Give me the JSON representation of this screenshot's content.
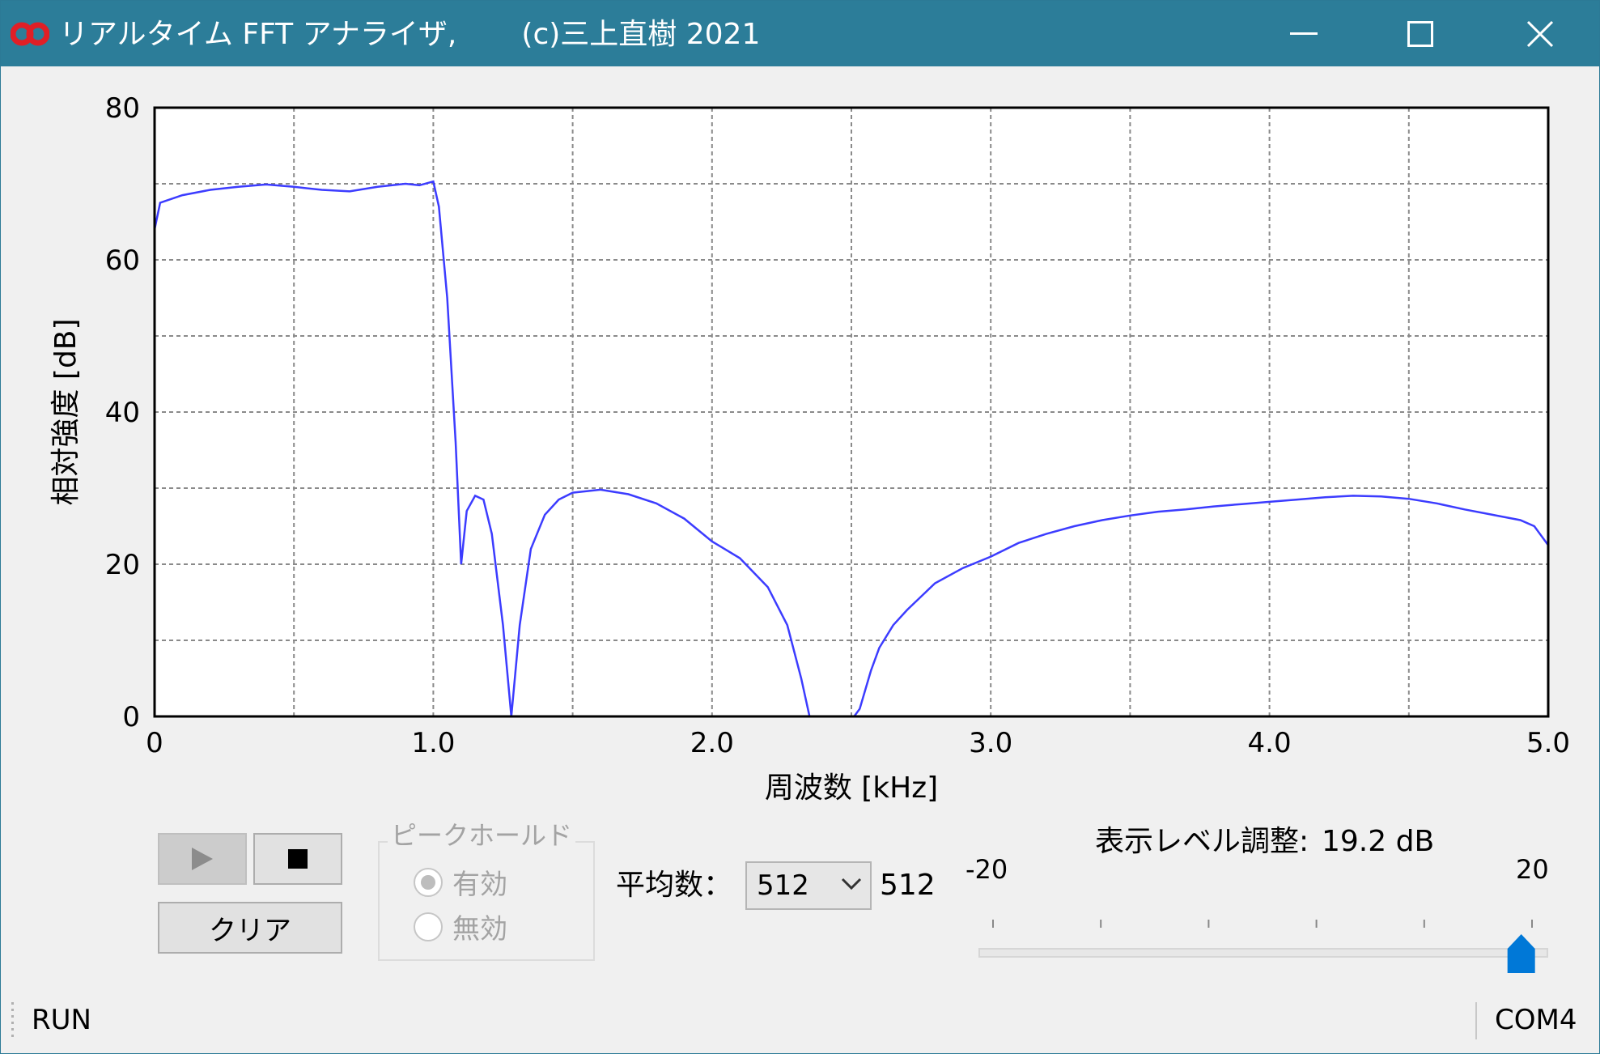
{
  "window": {
    "title": "リアルタイム FFT アナライザ,       (c)三上直樹 2021",
    "icon": "infinity-logo-icon",
    "controls": [
      "minimize-icon",
      "maximize-icon",
      "close-icon"
    ],
    "title_bar_color": "#2c7d99"
  },
  "chart_data": {
    "type": "line",
    "xlabel": "周波数 [kHz]",
    "ylabel": "相対強度 [dB]",
    "xlim": [
      0,
      5
    ],
    "ylim": [
      0,
      80
    ],
    "x_ticks": [
      0,
      1.0,
      2.0,
      3.0,
      4.0,
      5.0
    ],
    "x_tick_labels": [
      "0",
      "1.0",
      "2.0",
      "3.0",
      "4.0",
      "5.0"
    ],
    "y_ticks": [
      0,
      20,
      40,
      60,
      80
    ],
    "y_tick_labels": [
      "0",
      "20",
      "40",
      "60",
      "80"
    ],
    "grid": true,
    "line_color": "#3c3cff",
    "series": [
      {
        "values": [
          [
            0,
            64
          ],
          [
            0.02,
            67.5
          ],
          [
            0.1,
            68.5
          ],
          [
            0.2,
            69.2
          ],
          [
            0.3,
            69.6
          ],
          [
            0.4,
            69.9
          ],
          [
            0.5,
            69.6
          ],
          [
            0.6,
            69.2
          ],
          [
            0.7,
            69.0
          ],
          [
            0.8,
            69.6
          ],
          [
            0.9,
            70.0
          ],
          [
            0.95,
            69.8
          ],
          [
            1.0,
            70.3
          ],
          [
            1.02,
            67
          ],
          [
            1.05,
            55
          ],
          [
            1.08,
            36
          ],
          [
            1.1,
            20
          ],
          [
            1.12,
            27
          ],
          [
            1.15,
            29
          ],
          [
            1.18,
            28.5
          ],
          [
            1.21,
            24
          ],
          [
            1.25,
            12
          ],
          [
            1.28,
            0
          ],
          [
            1.31,
            12
          ],
          [
            1.35,
            22
          ],
          [
            1.4,
            26.5
          ],
          [
            1.45,
            28.5
          ],
          [
            1.5,
            29.4
          ],
          [
            1.6,
            29.8
          ],
          [
            1.7,
            29.2
          ],
          [
            1.8,
            28.0
          ],
          [
            1.9,
            26.0
          ],
          [
            2.0,
            23.0
          ],
          [
            2.1,
            20.8
          ],
          [
            2.2,
            17.0
          ],
          [
            2.27,
            12
          ],
          [
            2.32,
            5
          ],
          [
            2.35,
            0
          ],
          [
            2.51,
            0
          ],
          [
            2.53,
            1
          ],
          [
            2.57,
            6
          ],
          [
            2.6,
            9
          ],
          [
            2.65,
            12
          ],
          [
            2.7,
            14
          ],
          [
            2.8,
            17.5
          ],
          [
            2.9,
            19.5
          ],
          [
            3.0,
            21.0
          ],
          [
            3.1,
            22.8
          ],
          [
            3.2,
            24.0
          ],
          [
            3.3,
            25.0
          ],
          [
            3.4,
            25.8
          ],
          [
            3.5,
            26.4
          ],
          [
            3.6,
            26.9
          ],
          [
            3.7,
            27.2
          ],
          [
            3.8,
            27.6
          ],
          [
            3.9,
            27.9
          ],
          [
            4.0,
            28.2
          ],
          [
            4.1,
            28.5
          ],
          [
            4.2,
            28.8
          ],
          [
            4.3,
            29.0
          ],
          [
            4.4,
            28.9
          ],
          [
            4.5,
            28.6
          ],
          [
            4.6,
            28.0
          ],
          [
            4.7,
            27.2
          ],
          [
            4.8,
            26.5
          ],
          [
            4.9,
            25.8
          ],
          [
            4.95,
            25.0
          ],
          [
            5.0,
            22.5
          ]
        ]
      }
    ]
  },
  "controls": {
    "play_icon": "play-icon",
    "stop_icon": "stop-icon",
    "clear_label": "クリア",
    "peak_hold": {
      "title": "ピークホールド",
      "options": [
        {
          "label": "有効",
          "selected": true
        },
        {
          "label": "無効",
          "selected": false
        }
      ],
      "enabled": false
    },
    "average": {
      "label": "平均数：",
      "selected": "512",
      "value_text": "512"
    },
    "level": {
      "label": "表示レベル調整:",
      "value_text": "19.2 dB",
      "min_label": "-20",
      "max_label": "20",
      "min": -20,
      "max": 20,
      "value": 19.2,
      "accent": "#0078d7"
    }
  },
  "status": {
    "left": "RUN",
    "right": "COM4"
  }
}
